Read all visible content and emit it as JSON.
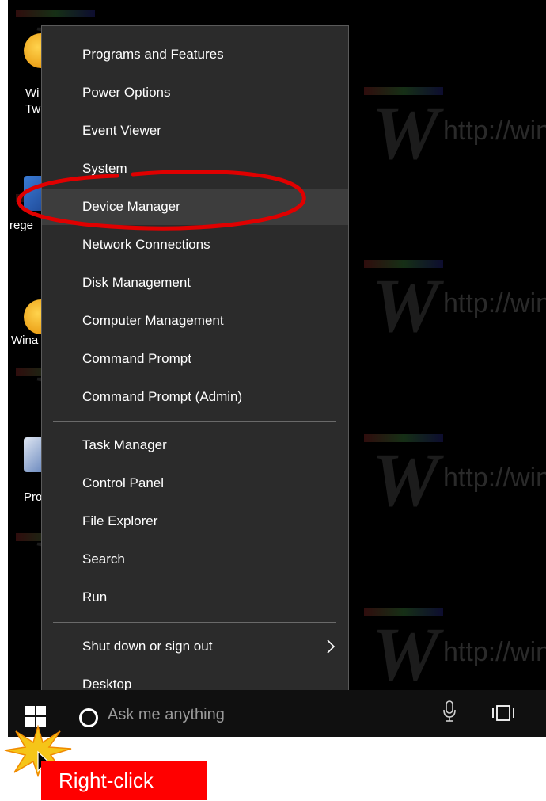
{
  "menu": {
    "items": [
      {
        "label": "Programs and Features"
      },
      {
        "label": "Power Options"
      },
      {
        "label": "Event Viewer"
      },
      {
        "label": "System"
      },
      {
        "label": "Device Manager"
      },
      {
        "label": "Network Connections"
      },
      {
        "label": "Disk Management"
      },
      {
        "label": "Computer Management"
      },
      {
        "label": "Command Prompt"
      },
      {
        "label": "Command Prompt (Admin)"
      },
      {
        "label": "Task Manager"
      },
      {
        "label": "Control Panel"
      },
      {
        "label": "File Explorer"
      },
      {
        "label": "Search"
      },
      {
        "label": "Run"
      },
      {
        "label": "Shut down or sign out"
      },
      {
        "label": "Desktop"
      }
    ],
    "highlighted": "Device Manager"
  },
  "desktop": {
    "icons": [
      {
        "label": "Wi\nTw"
      },
      {
        "label": "rege"
      },
      {
        "label": "Wina"
      },
      {
        "label": "Pro"
      }
    ],
    "watermark": "http://winaero.com"
  },
  "taskbar": {
    "search_placeholder": "Ask me anything"
  },
  "callout": {
    "label": "Right-click"
  },
  "colors": {
    "menu_bg": "#2b2b2b",
    "highlight_bg": "#3d3d3d",
    "annotation_red": "#ff0000",
    "desktop_bg": "#000000"
  }
}
